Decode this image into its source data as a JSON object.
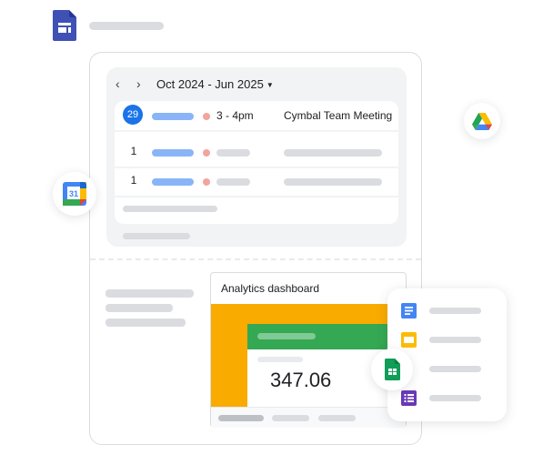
{
  "header": {
    "app_icon": "google-sites-icon"
  },
  "calendar": {
    "nav_prev_icon": "‹",
    "nav_next_icon": "›",
    "date_range": "Oct 2024 - Jun 2025",
    "dropdown_icon": "▼",
    "events": [
      {
        "day": "29",
        "highlighted": true,
        "time": "3 - 4pm",
        "title": "Cymbal Team Meeting"
      },
      {
        "day": "1",
        "highlighted": false
      },
      {
        "day": "1",
        "highlighted": false
      }
    ]
  },
  "dashboard": {
    "title": "Analytics dashboard",
    "metric_value": "347.06"
  },
  "floating_apps": {
    "calendar_icon_label": "31",
    "items": [
      "google-docs-icon",
      "google-slides-icon",
      "google-sheets-icon",
      "google-forms-icon"
    ]
  },
  "colors": {
    "blue": "#1a73e8",
    "yellow": "#f9ab00",
    "green": "#34a853",
    "purple": "#5e35b1",
    "sites": "#3f51b5"
  }
}
